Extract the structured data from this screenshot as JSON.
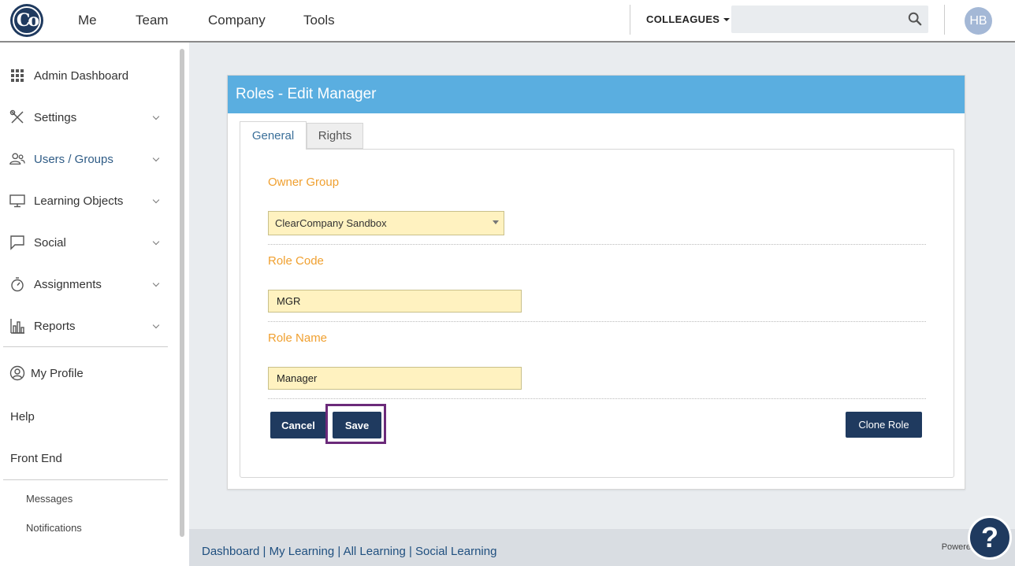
{
  "brand": {
    "logo_text": "Co"
  },
  "topnav": {
    "me": "Me",
    "team": "Team",
    "company": "Company",
    "tools": "Tools",
    "colleagues": "COLLEAGUES",
    "search_placeholder": "",
    "avatar": "HB"
  },
  "sidebar": {
    "items": [
      {
        "label": "Admin Dashboard",
        "icon": "grid-icon"
      },
      {
        "label": "Settings",
        "icon": "tools-icon"
      },
      {
        "label": "Users / Groups",
        "icon": "users-icon"
      },
      {
        "label": "Learning Objects",
        "icon": "monitor-icon"
      },
      {
        "label": "Social",
        "icon": "chat-icon"
      },
      {
        "label": "Assignments",
        "icon": "stopwatch-icon"
      },
      {
        "label": "Reports",
        "icon": "bar-chart-icon"
      }
    ],
    "my_profile": "My Profile",
    "help": "Help",
    "front_end": "Front End",
    "messages": "Messages",
    "notifications": "Notifications"
  },
  "card": {
    "title": "Roles - Edit Manager",
    "tabs": [
      {
        "label": "General",
        "active": true
      },
      {
        "label": "Rights",
        "active": false
      }
    ],
    "owner_group_label": "Owner Group",
    "owner_group_value": "ClearCompany Sandbox",
    "role_code_label": "Role Code",
    "role_code_value": "MGR",
    "role_name_label": "Role Name",
    "role_name_value": "Manager",
    "cancel": "Cancel",
    "save": "Save",
    "clone": "Clone Role"
  },
  "footer": {
    "links": [
      "Dashboard",
      "My Learning",
      "All Learning",
      "Social Learning"
    ],
    "powered": "Powere"
  },
  "help_button": "?",
  "colors": {
    "primary": "#1f3a5f",
    "header": "#5aaee0",
    "label": "#f0a030",
    "field": "#fff2c0",
    "highlight": "#6b2a7a"
  }
}
